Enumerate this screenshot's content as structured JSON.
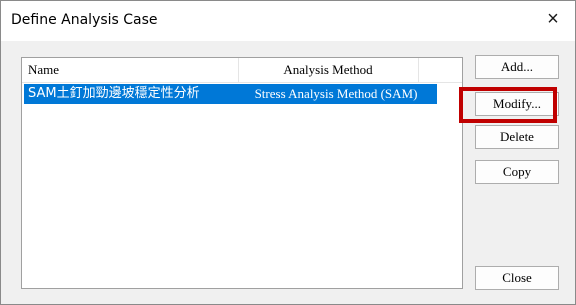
{
  "window": {
    "title": "Define Analysis Case",
    "close_glyph": "×"
  },
  "list": {
    "columns": [
      "Name",
      "Analysis Method"
    ],
    "rows": [
      {
        "name": "SAM土釘加勁邊坡穩定性分析",
        "method": "Stress Analysis Method (SAM)",
        "selected": true
      }
    ],
    "selection_color": "#0078d7"
  },
  "buttons": {
    "add": "Add...",
    "modify": "Modify...",
    "delete": "Delete",
    "copy": "Copy",
    "close": "Close"
  },
  "annotation": {
    "highlight_color": "#c00000",
    "highlight_target": "modify"
  }
}
